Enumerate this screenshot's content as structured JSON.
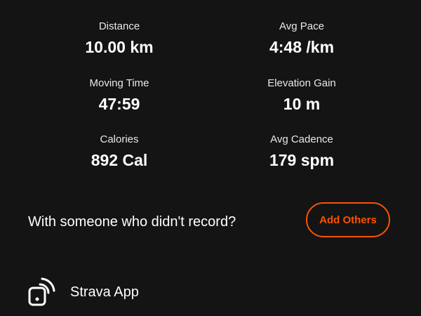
{
  "stats": {
    "distance": {
      "label": "Distance",
      "value": "10.00 km"
    },
    "avg_pace": {
      "label": "Avg Pace",
      "value": "4:48 /km"
    },
    "moving_time": {
      "label": "Moving Time",
      "value": "47:59"
    },
    "elevation_gain": {
      "label": "Elevation Gain",
      "value": "10 m"
    },
    "calories": {
      "label": "Calories",
      "value": "892 Cal"
    },
    "avg_cadence": {
      "label": "Avg Cadence",
      "value": "179 spm"
    }
  },
  "with_others": {
    "prompt": "With someone who didn't record?",
    "button_label": "Add Others"
  },
  "source": {
    "icon": "device-signal-icon",
    "label": "Strava App"
  },
  "colors": {
    "background": "#141414",
    "text": "#ffffff",
    "accent": "#fc5200"
  }
}
